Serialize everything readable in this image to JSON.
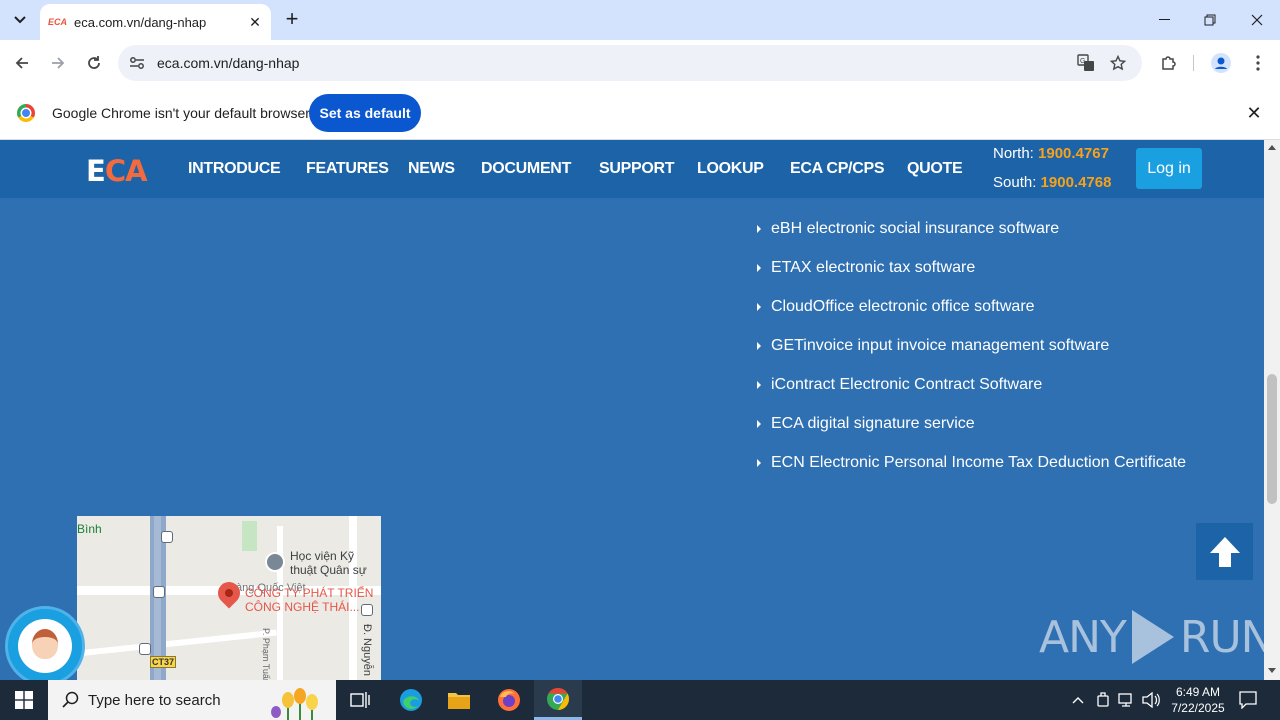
{
  "browser": {
    "tab_title": "eca.com.vn/dang-nhap",
    "tab_favicon_text": "ECA",
    "url": "eca.com.vn/dang-nhap",
    "infobar_text": "Google Chrome isn't your default browser",
    "set_default_label": "Set as default"
  },
  "site": {
    "logo_e": "E",
    "logo_ca": "CA",
    "nav": [
      "INTRODUCE",
      "FEATURES",
      "NEWS",
      "DOCUMENT",
      "SUPPORT",
      "LOOKUP",
      "ECA CP/CPS",
      "QUOTE"
    ],
    "hotline_north_label": "North: ",
    "hotline_north_number": "1900.4767",
    "hotline_south_label": "South: ",
    "hotline_south_number": "1900.4768",
    "login_label": "Log in",
    "products": [
      " eBH electronic social insurance software",
      "ETAX electronic tax software",
      "CloudOffice electronic office software",
      "GETinvoice input invoice management software",
      "iContract Electronic Contract Software",
      "ECA digital signature service",
      "ECN Electronic Personal Income Tax Deduction Certificate"
    ],
    "map": {
      "label_binh": "Bình",
      "label_hocvien_1": "Học viện Kỹ",
      "label_hocvien_2": "thuật Quân sự",
      "label_company_1": "CÔNG TY PHÁT TRIỂN",
      "label_company_2": "CÔNG NGHỆ THÁI...",
      "label_hoang": "Hoàng Quốc Việt",
      "label_pham": "P. Phạm Tuấn",
      "label_nguyen": "Đ. Nguyễn",
      "shield": "CT37"
    },
    "watermark_left": "ANY",
    "watermark_right": "RUN"
  },
  "taskbar": {
    "search_placeholder": "Type here to search",
    "time": "6:49 AM",
    "date": "7/22/2025"
  },
  "colors": {
    "page_bg": "#2e70b2",
    "navbar_bg": "#1d63a7",
    "accent_orange": "#f26a3f",
    "hotline_number": "#f7a21b",
    "login_bg": "#1a9fe0",
    "chrome_button": "#0b57d0"
  }
}
